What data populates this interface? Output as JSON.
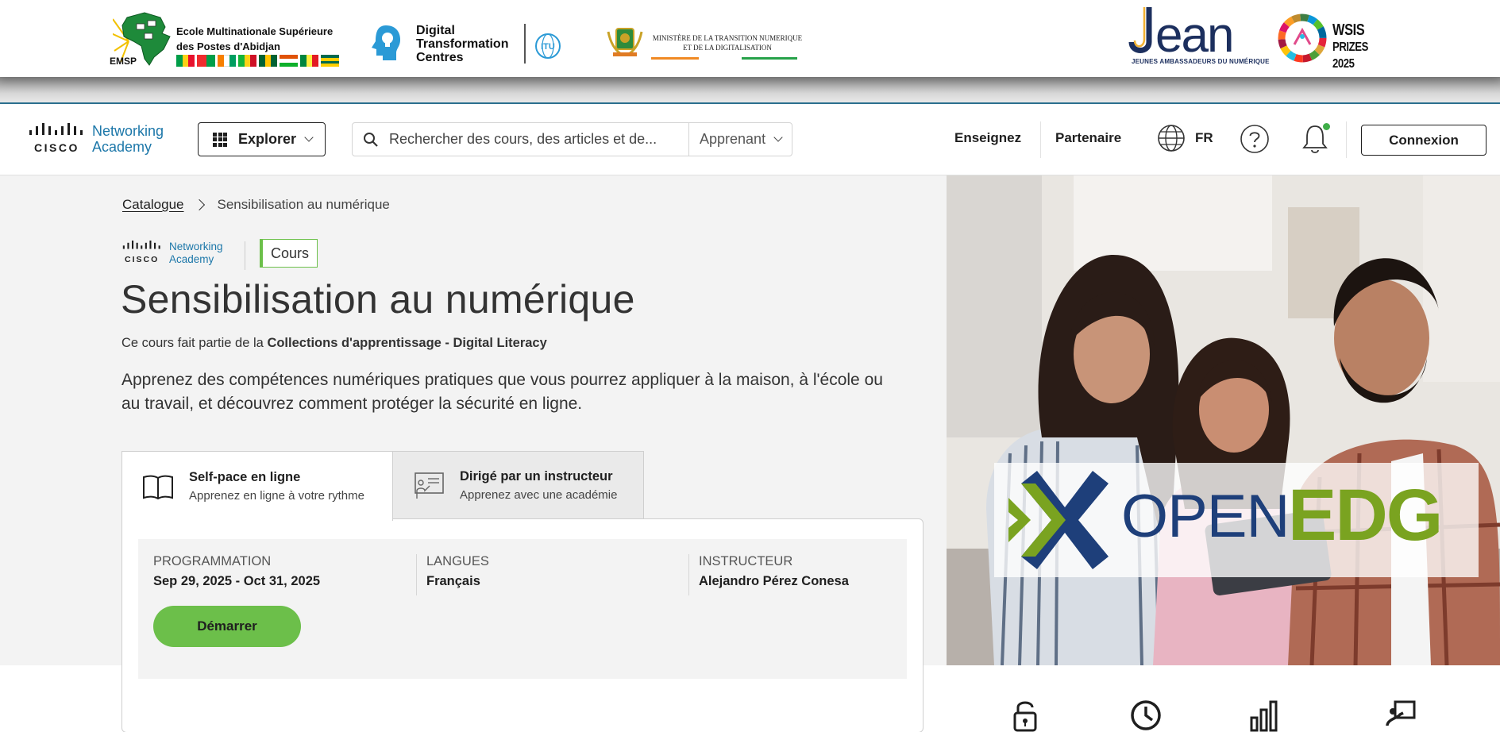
{
  "partners": {
    "emsp": {
      "abbr": "EMSP",
      "name_line1": "Ecole Multinationale Supérieure",
      "name_line2": "des Postes d'Abidjan"
    },
    "dtc": {
      "line1": "Digital",
      "line2": "Transformation",
      "line3": "Centres",
      "itu": "ITU"
    },
    "ministry": {
      "line1": "MINISTÈRE DE LA TRANSITION NUMERIQUE",
      "line2": "ET DE LA DIGITALISATION"
    },
    "jean": {
      "word": "Jean",
      "tagline": "JEUNES AMBASSADEURS DU NUMÉRIQUE"
    },
    "wsis": {
      "line1": "WSIS",
      "line2": "PRIZES 2025"
    }
  },
  "nav": {
    "logo_cisco": "CISCO",
    "logo_line1": "Networking",
    "logo_line2": "Academy",
    "explore_label": "Explorer",
    "search_placeholder": "Rechercher des cours, des articles et de...",
    "role_label": "Apprenant",
    "teach_label": "Enseignez",
    "partner_label": "Partenaire",
    "lang_label": "FR",
    "login_label": "Connexion"
  },
  "breadcrumb": {
    "catalog": "Catalogue",
    "current": "Sensibilisation au numérique"
  },
  "course": {
    "badge": "Cours",
    "title": "Sensibilisation au numérique",
    "collection_prefix": "Ce cours fait partie de la",
    "collection_name": "Collections d'apprentissage - Digital Literacy",
    "description": "Apprenez des compétences numériques pratiques que vous pourrez appliquer à la maison, à l'école ou au travail, et découvrez comment protéger la sécurité en ligne."
  },
  "tabs": [
    {
      "title": "Self-pace en ligne",
      "subtitle": "Apprenez en ligne à votre rythme"
    },
    {
      "title": "Dirigé par un instructeur",
      "subtitle": "Apprenez avec une académie"
    }
  ],
  "details": {
    "schedule_label": "PROGRAMMATION",
    "schedule_value": "Sep 29, 2025 - Oct 31, 2025",
    "languages_label": "LANGUES",
    "languages_value": "Français",
    "instructor_label": "INSTRUCTEUR",
    "instructor_value": "Alejandro Pérez Conesa",
    "start_label": "Démarrer"
  },
  "hero": {
    "brand_part1": "OPEN",
    "brand_part2": "EDG"
  },
  "stats_icons": [
    "lock-icon",
    "clock-icon",
    "bar-chart-icon",
    "instructor-icon"
  ],
  "colors": {
    "accent_green": "#6cbf4a",
    "cisco_blue": "#1c77a9",
    "edg_green": "#7aa320",
    "edg_blue": "#1e3f7a"
  }
}
